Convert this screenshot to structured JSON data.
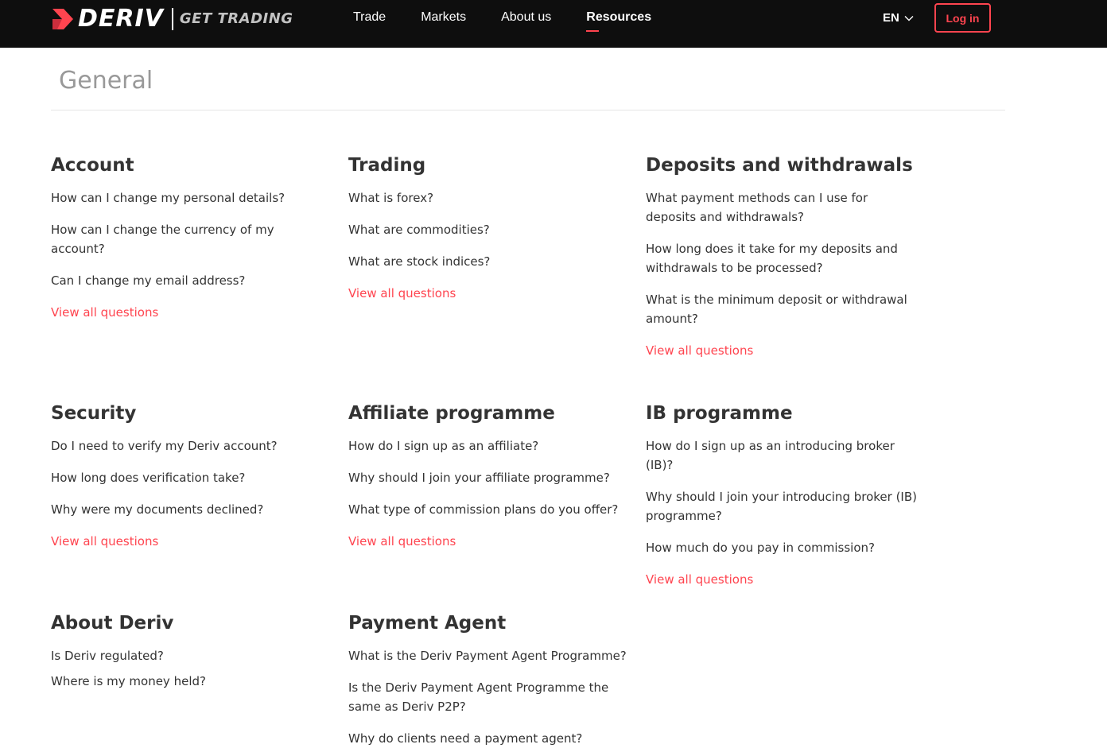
{
  "header": {
    "logo_text": "DERIV",
    "logo_tagline": "GET TRADING",
    "nav": [
      {
        "label": "Trade",
        "active": false
      },
      {
        "label": "Markets",
        "active": false
      },
      {
        "label": "About us",
        "active": false
      },
      {
        "label": "Resources",
        "active": true
      }
    ],
    "language": "EN",
    "login_label": "Log in",
    "accent_color": "#ff444f",
    "background_color": "#0e0e0e"
  },
  "page": {
    "title": "General"
  },
  "sections": [
    {
      "title": "Account",
      "questions": [
        "How can I change my personal details?",
        "How can I change the currency of my account?",
        "Can I change my email address?"
      ],
      "view_all": "View all questions"
    },
    {
      "title": "Trading",
      "questions": [
        "What is forex?",
        "What are commodities?",
        "What are stock indices?"
      ],
      "view_all": "View all questions"
    },
    {
      "title": "Deposits and withdrawals",
      "questions": [
        "What payment methods can I use for deposits and withdrawals?",
        "How long does it take for my deposits and withdrawals to be processed?",
        "What is the minimum deposit or withdrawal amount?"
      ],
      "view_all": "View all questions"
    },
    {
      "title": "Security",
      "questions": [
        "Do I need to verify my Deriv account?",
        "How long does verification take?",
        "Why were my documents declined?"
      ],
      "view_all": "View all questions"
    },
    {
      "title": "Affiliate programme",
      "questions": [
        "How do I sign up as an affiliate?",
        "Why should I join your affiliate programme?",
        "What type of commission plans do you offer?"
      ],
      "view_all": "View all questions"
    },
    {
      "title": "IB programme",
      "questions": [
        "How do I sign up as an introducing broker (IB)?",
        "Why should I join your introducing broker (IB) programme?",
        "How much do you pay in commission?"
      ],
      "view_all": "View all questions"
    },
    {
      "title": "About Deriv",
      "questions": [
        "Is Deriv regulated?",
        "Where is my money held?"
      ],
      "view_all": ""
    },
    {
      "title": "Payment Agent",
      "questions": [
        "What is the Deriv Payment Agent Programme?",
        "Is the Deriv Payment Agent Programme the same as Deriv P2P?",
        "Why do clients need a payment agent?"
      ],
      "view_all": ""
    }
  ]
}
